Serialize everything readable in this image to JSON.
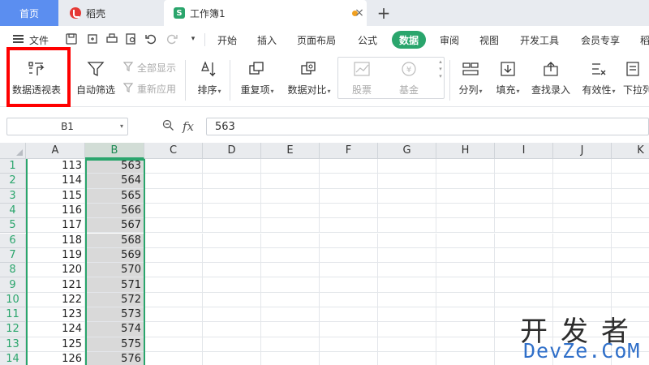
{
  "tabs": {
    "home": "首页",
    "daoke": "稻壳",
    "workbook": "工作簿1",
    "close": "×",
    "new_tab": "+"
  },
  "menu": {
    "file": "文件",
    "items": [
      "开始",
      "插入",
      "页面布局",
      "公式",
      "数据",
      "审阅",
      "视图",
      "开发工具",
      "会员专享",
      "稻"
    ],
    "active": "数据"
  },
  "ribbon": {
    "pivot": "数据透视表",
    "autofilter": "自动筛选",
    "show_all": "全部显示",
    "reapply": "重新应用",
    "sort": "排序",
    "duplicates": "重复项",
    "compare": "数据对比",
    "stock": "股票",
    "fund": "基金",
    "split": "分列",
    "fill": "填充",
    "lookup": "查找录入",
    "validity": "有效性",
    "dropdown": "下拉列"
  },
  "formula_bar": {
    "name_box": "B1",
    "fx": "fx",
    "value": "563"
  },
  "grid": {
    "columns": [
      "A",
      "B",
      "C",
      "D",
      "E",
      "F",
      "G",
      "H",
      "I",
      "J",
      "K"
    ],
    "rows": [
      "1",
      "2",
      "3",
      "4",
      "5",
      "6",
      "7",
      "8",
      "9",
      "10",
      "11",
      "12",
      "13",
      "14"
    ],
    "col_a": [
      113,
      114,
      115,
      116,
      117,
      118,
      119,
      120,
      121,
      122,
      123,
      124,
      125,
      126
    ],
    "col_b": [
      563,
      564,
      565,
      566,
      567,
      568,
      569,
      570,
      571,
      572,
      573,
      574,
      575,
      576
    ]
  },
  "watermark": {
    "line1": "开发者",
    "line2": "DevZe.CoM"
  },
  "colors": {
    "accent_green": "#2aa56c",
    "home_tab_blue": "#5b8ef0",
    "highlight_red": "#ff0000"
  }
}
